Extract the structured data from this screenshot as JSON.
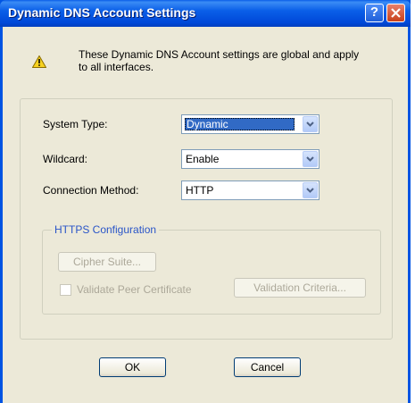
{
  "window": {
    "title": "Dynamic DNS Account Settings",
    "help_glyph": "?",
    "close_glyph": "×"
  },
  "notice": {
    "text": "These Dynamic DNS Account settings are global and apply to all interfaces."
  },
  "fields": {
    "system_type": {
      "label": "System Type:",
      "value": "Dynamic"
    },
    "wildcard": {
      "label": "Wildcard:",
      "value": "Enable"
    },
    "connection_method": {
      "label": "Connection Method:",
      "value": "HTTP"
    }
  },
  "https_config": {
    "legend": "HTTPS Configuration",
    "cipher_suite_label": "Cipher Suite...",
    "validate_peer_label": "Validate Peer Certificate",
    "validate_peer_checked": false,
    "validation_criteria_label": "Validation Criteria..."
  },
  "buttons": {
    "ok_label": "OK",
    "cancel_label": "Cancel"
  },
  "colors": {
    "title_bar": "#0a5fe8",
    "dialog_bg": "#ece9d8",
    "legend_text": "#2a55c8",
    "disabled_text": "#aca899"
  }
}
